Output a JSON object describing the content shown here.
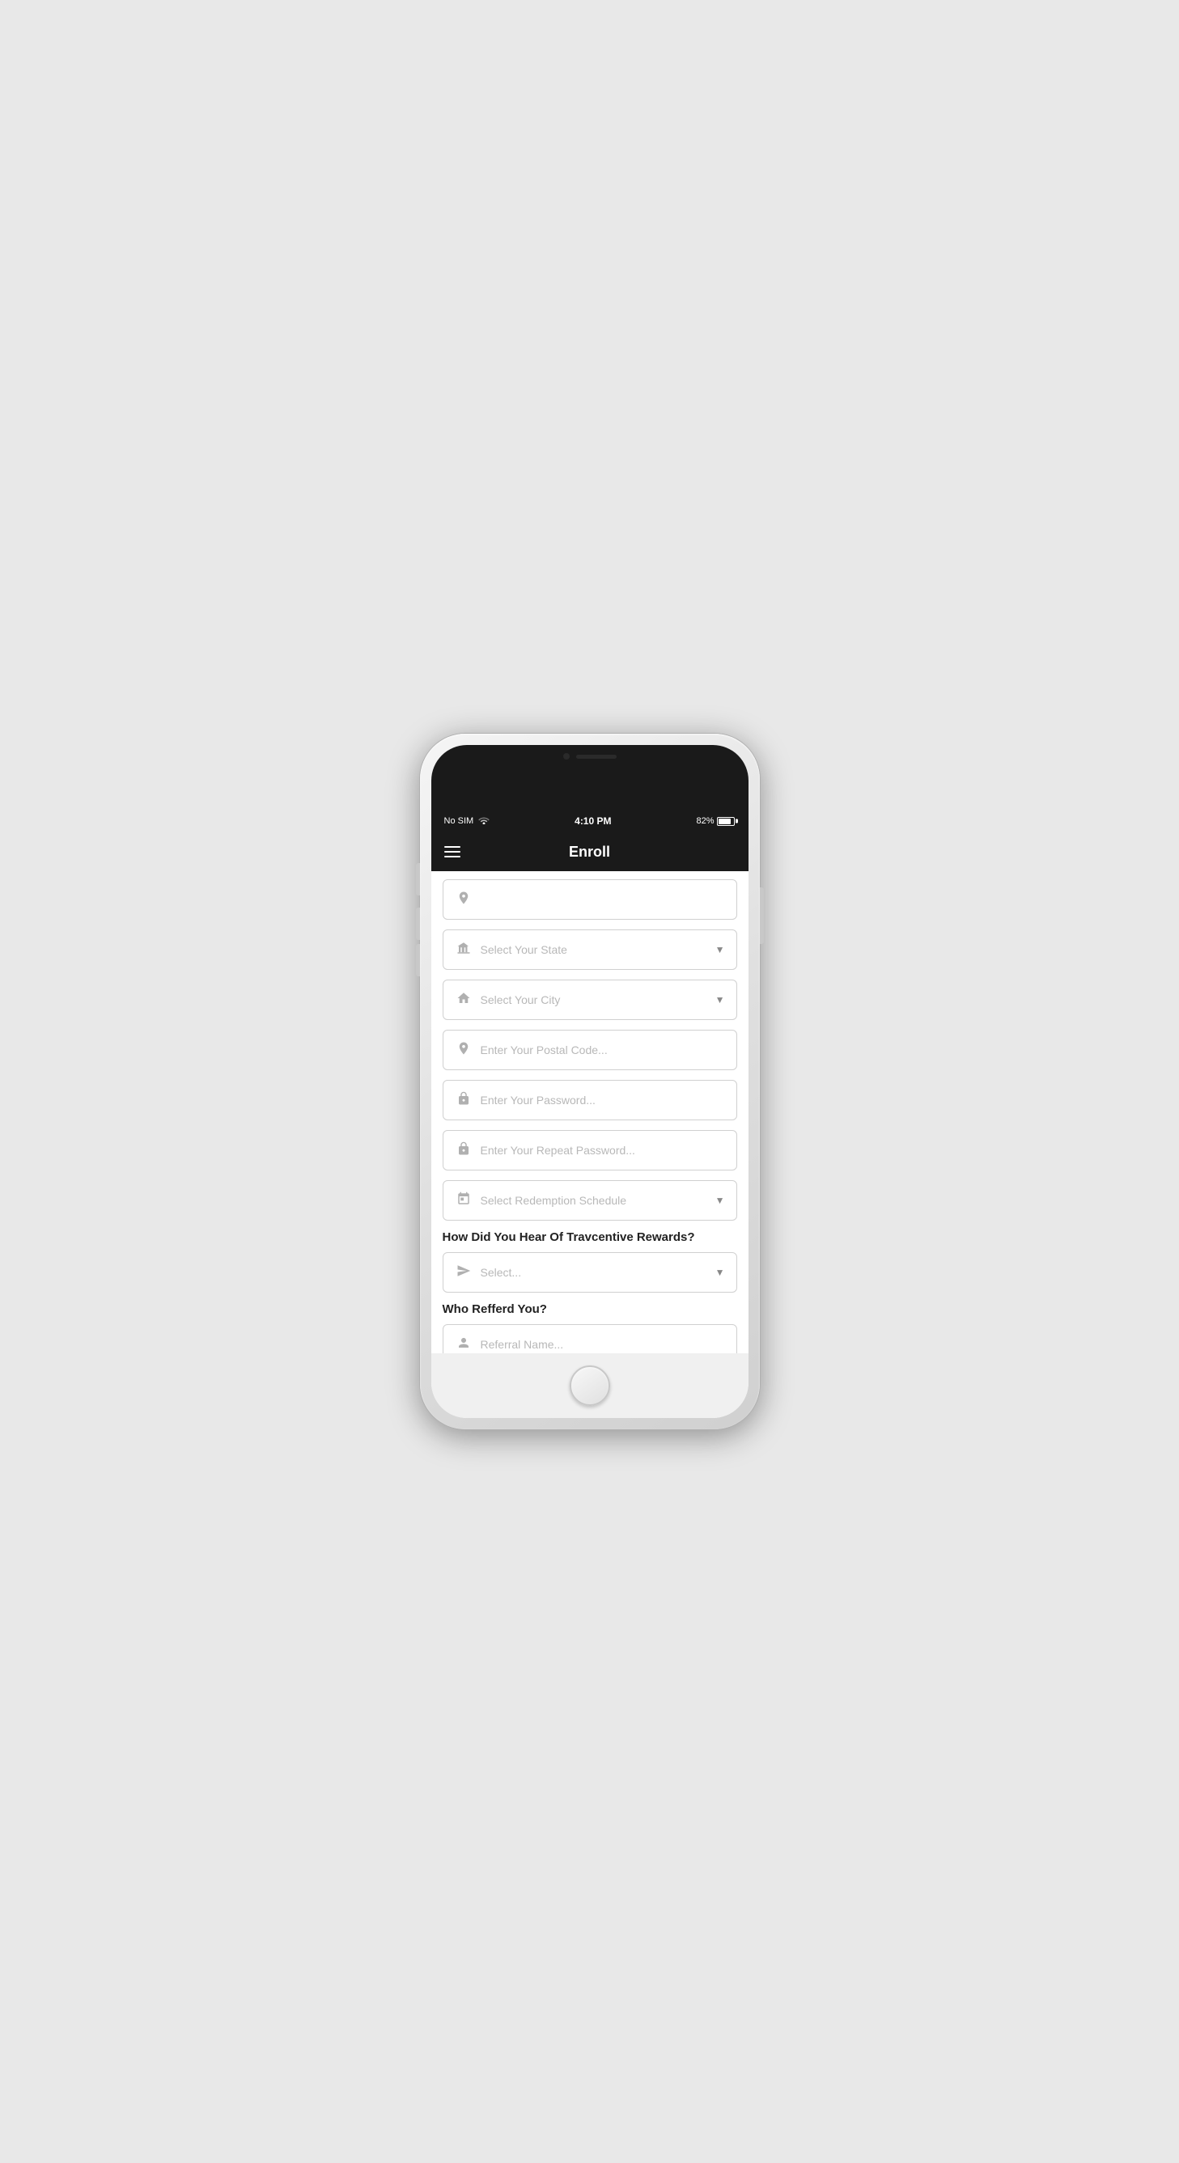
{
  "statusBar": {
    "carrier": "No SIM",
    "time": "4:10 PM",
    "battery": "82%"
  },
  "navBar": {
    "title": "Enroll",
    "menuLabel": "Menu"
  },
  "form": {
    "partialField": {
      "placeholder": ""
    },
    "stateDropdown": {
      "placeholder": "Select Your State",
      "icon": "bank"
    },
    "cityDropdown": {
      "placeholder": "Select Your City",
      "icon": "home"
    },
    "postalCode": {
      "placeholder": "Enter Your Postal Code...",
      "icon": "location"
    },
    "password": {
      "placeholder": "Enter Your Password...",
      "icon": "lock"
    },
    "repeatPassword": {
      "placeholder": "Enter Your Repeat Password...",
      "icon": "lock"
    },
    "redemptionSchedule": {
      "placeholder": "Select Redemption Schedule",
      "icon": "calendar"
    },
    "hearAboutSection": {
      "label": "How Did You Hear Of Travcentive Rewards?",
      "placeholder": "Select...",
      "icon": "send"
    },
    "referredSection": {
      "label": "Who Refferd You?",
      "placeholder": "Referral Name...",
      "icon": "person"
    }
  }
}
